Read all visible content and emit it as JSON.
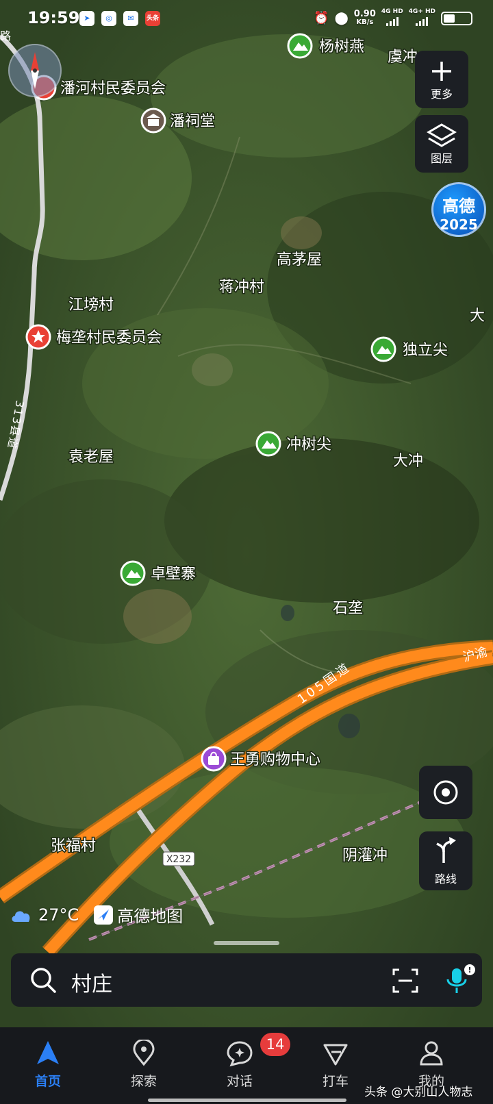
{
  "status_bar": {
    "time": "19:59",
    "notif_badge_text": "头条",
    "net_speed_value": "0.90",
    "net_speed_unit": "KB/s",
    "sim1_label": "4G HD",
    "sim2_label": "4G+ HD"
  },
  "map": {
    "labels": {
      "yangshuyan": "杨树燕",
      "yuchong": "虞冲",
      "panhe_committee": "潘河村民委员会",
      "panci_tang": "潘祠堂",
      "gaomaowu": "高茅屋",
      "jiangchong_cun": "蒋冲村",
      "jiangbang_cun": "江塝村",
      "meiya_committee": "梅垄村民委员会",
      "dulijian": "独立尖",
      "chongshujian": "冲树尖",
      "dachong": "大冲",
      "yuanlaowu": "袁老屋",
      "zhuobizhai": "卓壁寨",
      "shiya": "石垄",
      "wangyong_mall": "王勇购物中心",
      "zhangfu_cun": "张福村",
      "yinguanchong": "阴灌冲",
      "road_105": "105国道",
      "road_313": "313县道",
      "road_x232": "X232",
      "road_huyu": "沪渝",
      "edge_da": "大",
      "edge_lu": "路"
    }
  },
  "side_buttons": {
    "more_label": "更多",
    "layers_label": "图层",
    "brand_line1": "高德",
    "brand_line2": "2025",
    "route_label": "路线"
  },
  "weather": {
    "temperature": "27°C",
    "logo_text": "高德地图"
  },
  "search": {
    "text": "村庄"
  },
  "tabs": [
    {
      "label": "首页"
    },
    {
      "label": "探索"
    },
    {
      "label": "对话"
    },
    {
      "label": "打车"
    },
    {
      "label": "我的"
    }
  ],
  "dialog_badge": "14",
  "watermark": "头条 @大别山人物志",
  "colors": {
    "accent": "#2b7ff5",
    "highway": "#ff8a1c",
    "mountain_poi": "#3aa935",
    "red_poi": "#e94035",
    "mall_poi": "#9b4bd6"
  }
}
